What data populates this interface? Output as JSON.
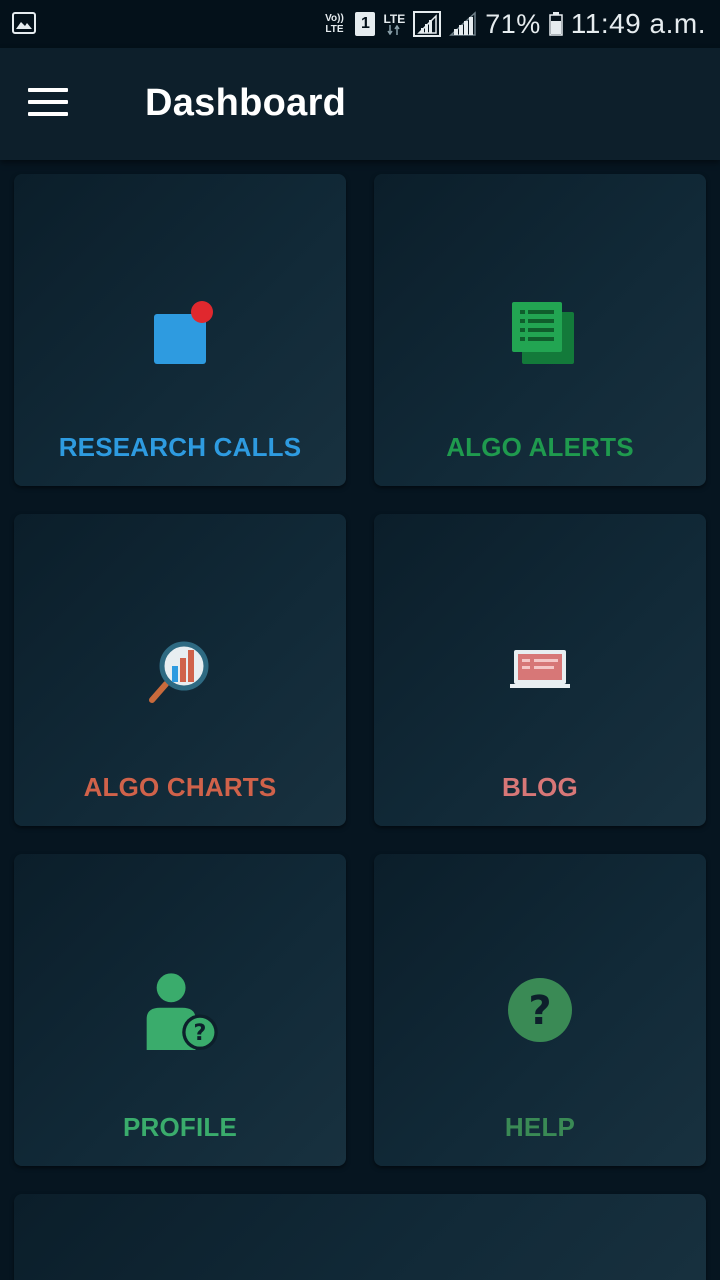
{
  "status_bar": {
    "volte_line1": "Vo))",
    "volte_line2": "LTE",
    "sim": "1",
    "network": "LTE",
    "battery": "71%",
    "time": "11:49 a.m."
  },
  "app_bar": {
    "title": "Dashboard"
  },
  "tiles": [
    {
      "label": "RESEARCH CALLS",
      "color": "#2e9be0",
      "icon": "research-calls-icon"
    },
    {
      "label": "ALGO ALERTS",
      "color": "#1f9a4e",
      "icon": "algo-alerts-icon"
    },
    {
      "label": "ALGO CHARTS",
      "color": "#d0624a",
      "icon": "algo-charts-icon"
    },
    {
      "label": "BLOG",
      "color": "#d77777",
      "icon": "blog-icon"
    },
    {
      "label": "PROFILE",
      "color": "#3aac6c",
      "icon": "profile-icon"
    },
    {
      "label": "HELP",
      "color": "#3a8a55",
      "icon": "help-icon"
    }
  ]
}
